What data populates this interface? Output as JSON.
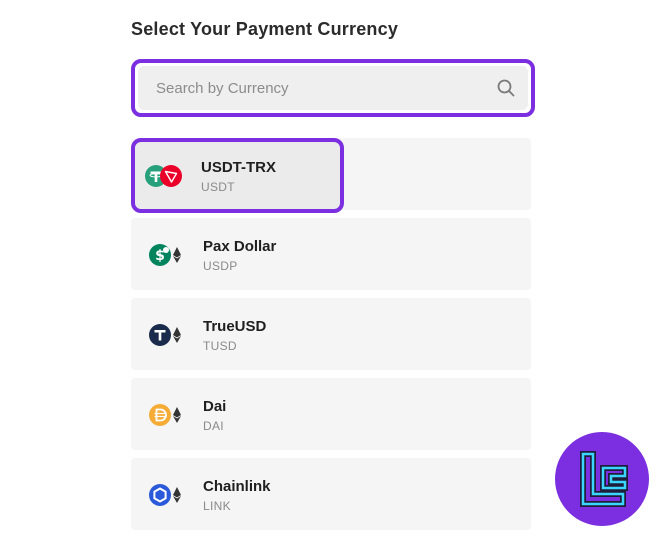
{
  "header": {
    "title": "Select Your Payment Currency"
  },
  "search": {
    "placeholder": "Search by Currency",
    "value": ""
  },
  "currencies": [
    {
      "name": "USDT-TRX",
      "symbol": "USDT",
      "selected": true
    },
    {
      "name": "Pax Dollar",
      "symbol": "USDP",
      "selected": false
    },
    {
      "name": "TrueUSD",
      "symbol": "TUSD",
      "selected": false
    },
    {
      "name": "Dai",
      "symbol": "DAI",
      "selected": false
    },
    {
      "name": "Chainlink",
      "symbol": "LINK",
      "selected": false
    }
  ],
  "colors": {
    "accent": "#7b2fe0",
    "card_bg": "#f5f5f5",
    "search_bg": "#efefef",
    "tether": "#26a17b",
    "tron": "#eb0029",
    "pax": "#00845d",
    "trueusd": "#1a2b4c",
    "dai": "#f5ac37",
    "chainlink": "#2a5ada",
    "ethereum": "#343434"
  }
}
